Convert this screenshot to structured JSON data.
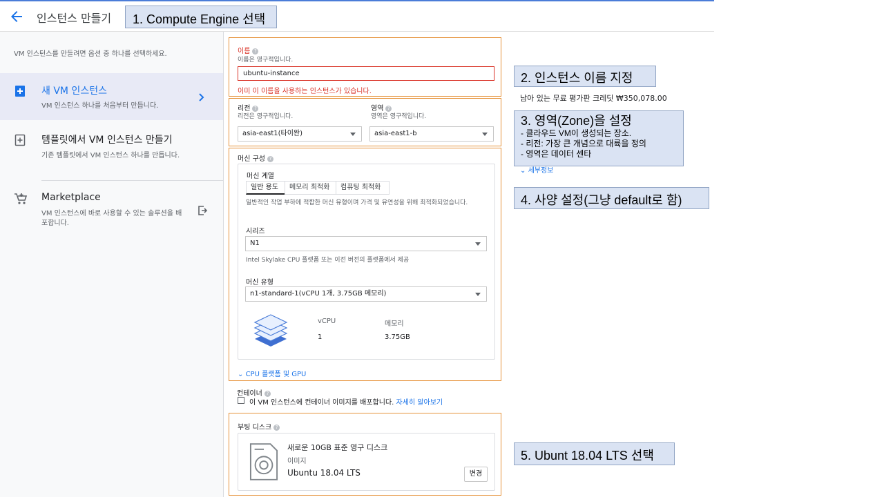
{
  "header": {
    "title": "인스턴스 만들기"
  },
  "callouts": {
    "c1": "1.  Compute Engine 선택",
    "c2": "2. 인스턴스 이름 지정",
    "c3_title": "3. 영역(Zone)을 설정",
    "c3_lines": [
      "- 클라우드 VM이 생성되는 장소.",
      "- 리전: 가장 큰 개념으로 대륙을 정의",
      "- 영역은 데이터 센타"
    ],
    "c4": "4. 사양 설정(그냥 default로 함)",
    "c5": "5. Ubunt 18.04 LTS  선택"
  },
  "sidebar": {
    "intro": "VM 인스턴스를 만들려면 옵션 중 하나를 선택하세요.",
    "items": [
      {
        "title": "새 VM 인스턴스",
        "desc": "VM 인스턴스 하나를 처음부터 만듭니다."
      },
      {
        "title": "템플릿에서 VM 인스턴스 만들기",
        "desc": "기존 템플릿에서 VM 인스턴스 하나를 만듭니다."
      },
      {
        "title": "Marketplace",
        "desc": "VM 인스턴스에 바로 사용할 수 있는 솔루션을 배포합니다."
      }
    ]
  },
  "credit": "남아 있는 무료 평가판 크레딧 ₩350,078.00",
  "details_link": "세부정보",
  "name_section": {
    "label": "이름",
    "note": "이름은 영구적입니다.",
    "value": "ubuntu-instance",
    "error": "이미 이 이름을 사용하는 인스턴스가 있습니다."
  },
  "region_section": {
    "region_label": "리전",
    "region_note": "리전은 영구적입니다.",
    "region_value": "asia-east1(타이완)",
    "zone_label": "영역",
    "zone_note": "영역은 영구적입니다.",
    "zone_value": "asia-east1-b"
  },
  "machine": {
    "title": "머신 구성",
    "family_label": "머신 계열",
    "tabs": [
      "일반 용도",
      "메모리 최적화",
      "컴퓨팅 최적화"
    ],
    "family_desc": "일반적인 작업 부하에 적합한 머신 유형이며 가격 및 유연성을 위해 최적화되었습니다.",
    "series_label": "시리즈",
    "series_value": "N1",
    "series_desc": "Intel Skylake CPU 플랫폼 또는 이전 버전의 플랫폼에서 제공",
    "type_label": "머신 유형",
    "type_value": "n1-standard-1(vCPU 1개, 3.75GB 메모리)",
    "vcpu_header": "vCPU",
    "mem_header": "메모리",
    "vcpu_value": "1",
    "mem_value": "3.75GB",
    "cpu_gpu_link": "CPU 플랫폼 및 GPU"
  },
  "container": {
    "label": "컨테이너",
    "checkbox_text": "이 VM 인스턴스에 컨테이너 이미지를 배포합니다.",
    "link": "자세히 알아보기"
  },
  "boot_disk": {
    "label": "부팅 디스크",
    "title": "새로운 10GB 표준 영구 디스크",
    "image_label": "이미지",
    "image_value": "Ubuntu 18.04 LTS",
    "change_button": "변경"
  },
  "colors": {
    "accent": "#1a73e8",
    "error": "#d93025",
    "highlight_border": "#e69138",
    "callout_bg": "#dae3f3"
  }
}
